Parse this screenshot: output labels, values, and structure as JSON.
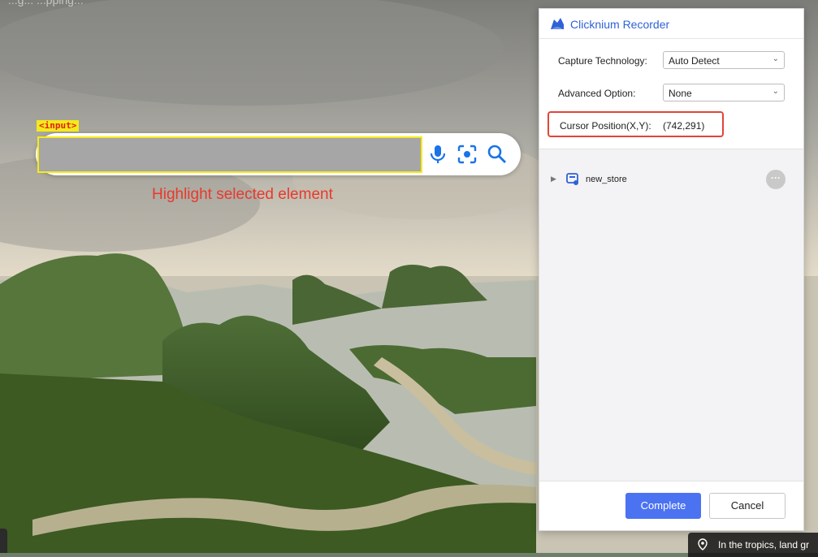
{
  "page": {
    "faded_top_text": "...g... ...pping..."
  },
  "overlay": {
    "highlight_tag": "<input>",
    "caption": "Highlight selected element",
    "icons": [
      "microphone-icon",
      "lens-icon",
      "search-icon"
    ]
  },
  "recorder": {
    "title": "Clicknium Recorder",
    "capture_label": "Capture Technology:",
    "capture_value": "Auto Detect",
    "advanced_label": "Advanced Option:",
    "advanced_value": "None",
    "cursor_label": "Cursor Position(X,Y):",
    "cursor_value": "(742,291)",
    "tree": {
      "item_label": "new_store",
      "more_label": "···"
    },
    "complete_label": "Complete",
    "cancel_label": "Cancel"
  },
  "tooltip": {
    "text": "In the tropics, land gr"
  },
  "colors": {
    "accent": "#4b72f1",
    "highlight": "#f5ea19",
    "alert": "#e2453a",
    "title_blue": "#2f62d6"
  }
}
